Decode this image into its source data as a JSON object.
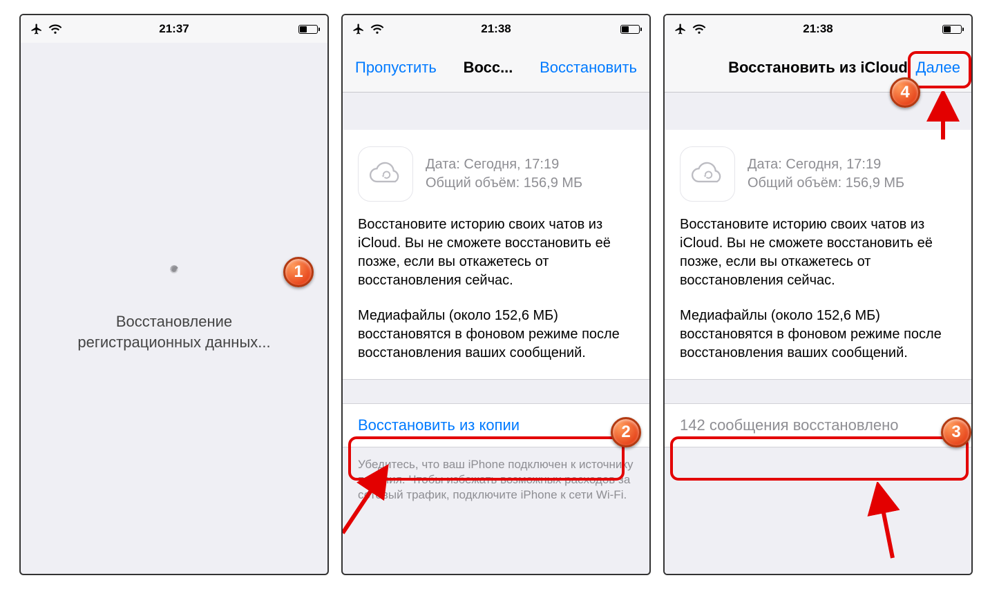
{
  "screen1": {
    "status_time": "21:37",
    "loading_text_line1": "Восстановление",
    "loading_text_line2": "регистрационных данных..."
  },
  "screen2": {
    "status_time": "21:38",
    "nav_skip": "Пропустить",
    "nav_title": "Восс...",
    "nav_restore": "Восстановить",
    "backup_date_label": "Дата: Сегодня, 17:19",
    "backup_size_label": "Общий объём: 156,9 МБ",
    "paragraph1": "Восстановите историю своих чатов из iCloud. Вы не сможете восстановить её позже, если вы откажетесь от восстановления сейчас.",
    "paragraph2": "Медиафайлы (около 152,6 МБ) восстановятся в фоновом режиме после восстановления ваших сообщений.",
    "restore_button": "Восстановить из копии",
    "footnote": "Убедитесь, что ваш iPhone подключен к источнику питания. Чтобы избежать возможных расходов за сотовый трафик, подключите iPhone к сети Wi-Fi."
  },
  "screen3": {
    "status_time": "21:38",
    "nav_title": "Восстановить из iCloud",
    "nav_next": "Далее",
    "backup_date_label": "Дата: Сегодня, 17:19",
    "backup_size_label": "Общий объём: 156,9 МБ",
    "paragraph1": "Восстановите историю своих чатов из iCloud. Вы не сможете восстановить её позже, если вы откажетесь от восстановления сейчас.",
    "paragraph2": "Медиафайлы (около 152,6 МБ) восстановятся в фоновом режиме после восстановления ваших сообщений.",
    "restored_status": "142 сообщения восстановлено"
  },
  "annotations": {
    "badge1": "1",
    "badge2": "2",
    "badge3": "3",
    "badge4": "4"
  }
}
